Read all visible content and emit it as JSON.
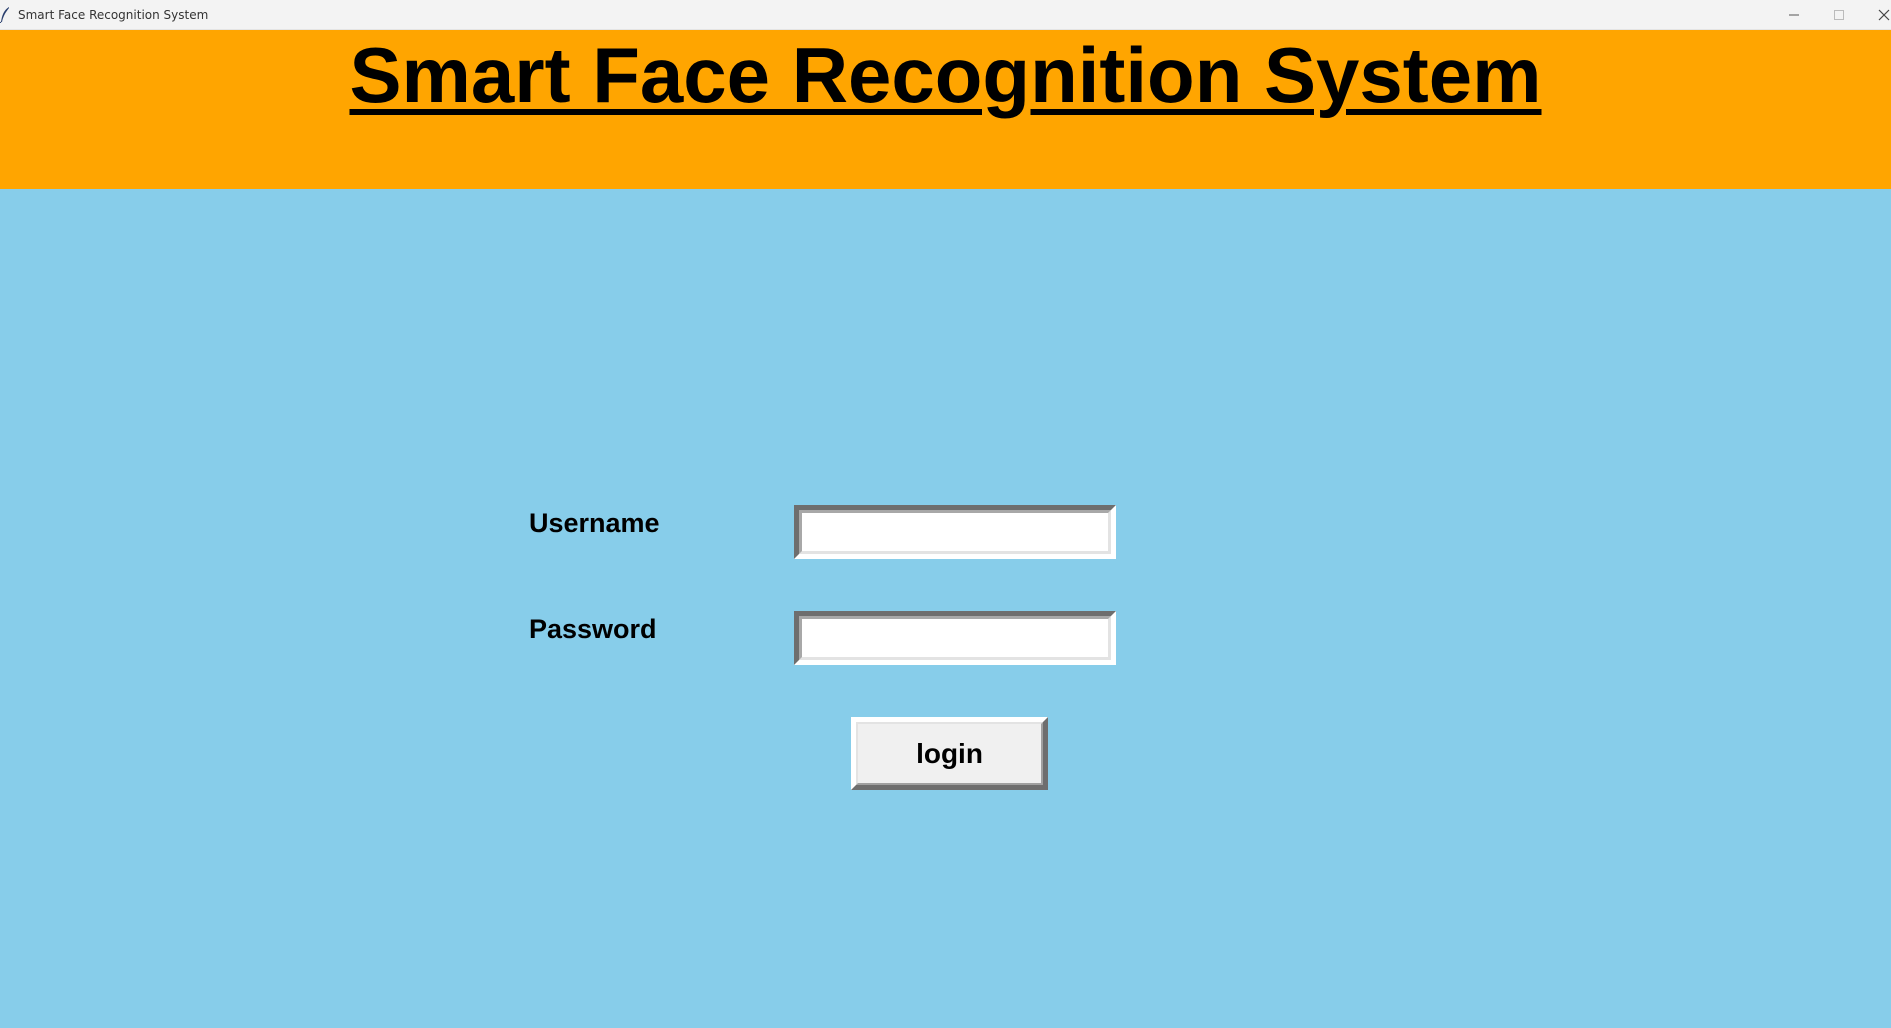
{
  "window": {
    "title": "Smart Face Recognition System",
    "icon": "feather-icon",
    "controls": [
      "minimize-icon",
      "maximize-icon",
      "close-icon"
    ]
  },
  "header": {
    "title": "Smart Face Recognition System",
    "background_color": "#ffa500"
  },
  "form": {
    "username_label": "Username",
    "username_value": "",
    "password_label": "Password",
    "password_value": "",
    "login_label": "login"
  },
  "colors": {
    "background": "#87cdea",
    "header": "#ffa500",
    "field": "#ffffff",
    "button": "#f0f0f0"
  }
}
